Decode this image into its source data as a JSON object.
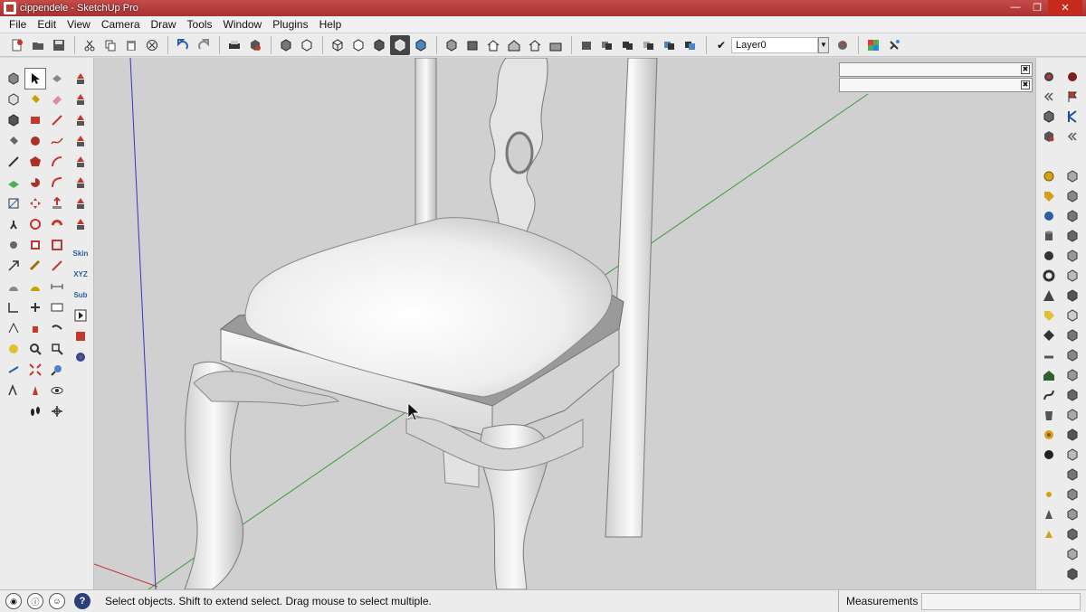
{
  "window": {
    "title": "cippendele - SketchUp Pro",
    "controls": {
      "minimize": "—",
      "maximize": "❐",
      "close": "✕"
    }
  },
  "menu": [
    "File",
    "Edit",
    "View",
    "Camera",
    "Draw",
    "Tools",
    "Window",
    "Plugins",
    "Help"
  ],
  "toolbar": {
    "layer": {
      "checked": "✔",
      "name": "Layer0",
      "dropdown": "▼"
    }
  },
  "left_palette": {
    "extension_labels": [
      "Skin",
      "XYZ",
      "Sub"
    ],
    "selected_tool": "select-tool"
  },
  "viewport": {
    "background": "#cfd0cf",
    "axis_colors": {
      "green": "#3c9a3c",
      "blue": "#3434c8",
      "red": "#c83434"
    }
  },
  "panels": [
    {
      "close": "✖"
    },
    {
      "close": "✖"
    }
  ],
  "statusbar": {
    "help_glyph": "?",
    "message": "Select objects. Shift to extend select. Drag mouse to select multiple.",
    "measurements_label": "Measurements",
    "measurements_value": ""
  }
}
